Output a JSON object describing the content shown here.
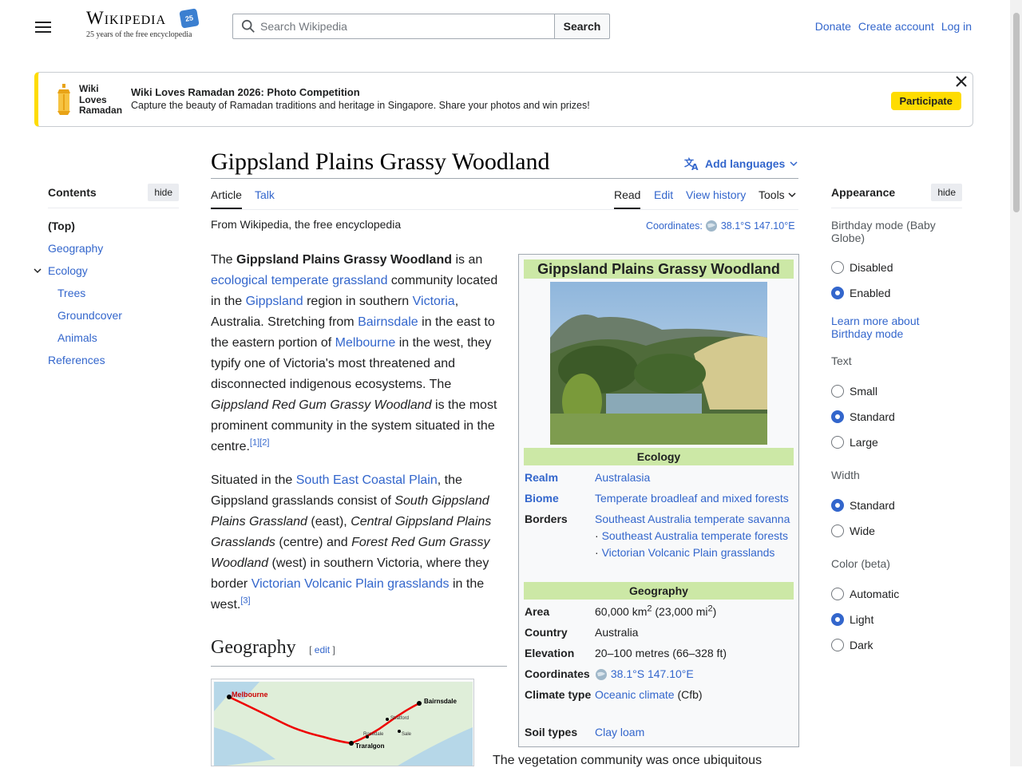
{
  "header": {
    "logo_wordmark": "Wikipedia",
    "logo_tagline": "25 years of the free encyclopedia",
    "logo_badge": "25",
    "search_placeholder": "Search Wikipedia",
    "search_button": "Search",
    "nav": [
      "Donate",
      "Create account",
      "Log in"
    ]
  },
  "banner": {
    "logo_lines": [
      "Wiki",
      "Loves",
      "Ramadan"
    ],
    "title": "Wiki Loves Ramadan 2026: Photo Competition",
    "subtitle": "Capture the beauty of Ramadan traditions and heritage in Singapore. Share your photos and win prizes!",
    "button": "Participate",
    "accent": "#fedc00"
  },
  "toc": {
    "title": "Contents",
    "hide": "hide",
    "items": [
      {
        "label": "(Top)"
      },
      {
        "label": "Geography"
      },
      {
        "label": "Ecology"
      },
      {
        "label": "Trees"
      },
      {
        "label": "Groundcover"
      },
      {
        "label": "Animals"
      },
      {
        "label": "References"
      }
    ]
  },
  "article": {
    "title": "Gippsland Plains Grassy Woodland",
    "add_languages": "Add languages",
    "tabs": {
      "article": "Article",
      "talk": "Talk",
      "read": "Read",
      "edit": "Edit",
      "history": "View history",
      "tools": "Tools"
    },
    "from": "From Wikipedia, the free encyclopedia",
    "coords_label": "Coordinates:",
    "coords_value": "38.1°S 147.10°E",
    "p1": {
      "t1": "The ",
      "bold": "Gippsland Plains Grassy Woodland",
      "t2": " is an ",
      "l1": "ecological temperate grassland",
      "t3": " community located in the ",
      "l2": "Gippsland",
      "t4": " region in southern ",
      "l3": "Victoria",
      "t5": ", Australia. Stretching from ",
      "l4": "Bairnsdale",
      "t6": " in the east to the eastern portion of ",
      "l5": "Melbourne",
      "t7": " in the west, they typify one of Victoria's most threatened and disconnected indigenous ecosystems. The ",
      "i1": "Gippsland Red Gum Grassy Woodland",
      "t8": " is the most prominent community in the system situated in the centre.",
      "ref": "[1][2]"
    },
    "p2": {
      "t1": "Situated in the ",
      "l1": "South East Coastal Plain",
      "t2": ", the Gippsland grasslands consist of ",
      "i1": "South Gippsland Plains Grassland",
      "t3": " (east), ",
      "i2": "Central Gippsland Plains Grasslands",
      "t4": " (centre) and ",
      "i3": "Forest Red Gum Grassy Woodland",
      "t5": " (west) in southern Victoria, where they border ",
      "l2": "Victorian Volcanic Plain grasslands",
      "t6": " in the west.",
      "ref": "[3]"
    },
    "geography_heading": "Geography",
    "edit_link": "edit",
    "veg_text": "The vegetation community was once ubiquitous",
    "map": {
      "labels": [
        "Melbourne",
        "Bairnsdale",
        "Traralgon",
        "Sale",
        "Stratford",
        "Rosedale"
      ]
    }
  },
  "infobox": {
    "title": "Gippsland Plains Grassy Woodland",
    "sec_ecology": "Ecology",
    "sec_geography": "Geography",
    "realm_k": "Realm",
    "realm_v": "Australasia",
    "biome_k": "Biome",
    "biome_v": "Temperate broadleaf and mixed forests",
    "borders_k": "Borders",
    "borders_1": "Southeast Australia temperate savanna",
    "borders_2": "Southeast Australia temperate forests",
    "borders_3": "Victorian Volcanic Plain grasslands",
    "area_k": "Area",
    "area_v1": "60,000 km",
    "area_v2": " (23,000 mi",
    "area_v3": ")",
    "country_k": "Country",
    "country_v": "Australia",
    "elev_k": "Elevation",
    "elev_v": "20–100 metres (66–328 ft)",
    "coord_k": "Coordinates",
    "coord_v": "38.1°S 147.10°E",
    "climate_k": "Climate type",
    "climate_v1": "Oceanic climate",
    "climate_v2": " (Cfb)",
    "soil_k": "Soil types",
    "soil_v": "Clay loam",
    "header_color": "#cce8a6"
  },
  "appearance": {
    "title": "Appearance",
    "hide": "hide",
    "birthday_label": "Birthday mode (Baby Globe)",
    "birthday_opts": [
      "Disabled",
      "Enabled"
    ],
    "learn": "Learn more about Birthday mode",
    "text_label": "Text",
    "text_opts": [
      "Small",
      "Standard",
      "Large"
    ],
    "width_label": "Width",
    "width_opts": [
      "Standard",
      "Wide"
    ],
    "color_label": "Color (beta)",
    "color_opts": [
      "Automatic",
      "Light",
      "Dark"
    ]
  }
}
